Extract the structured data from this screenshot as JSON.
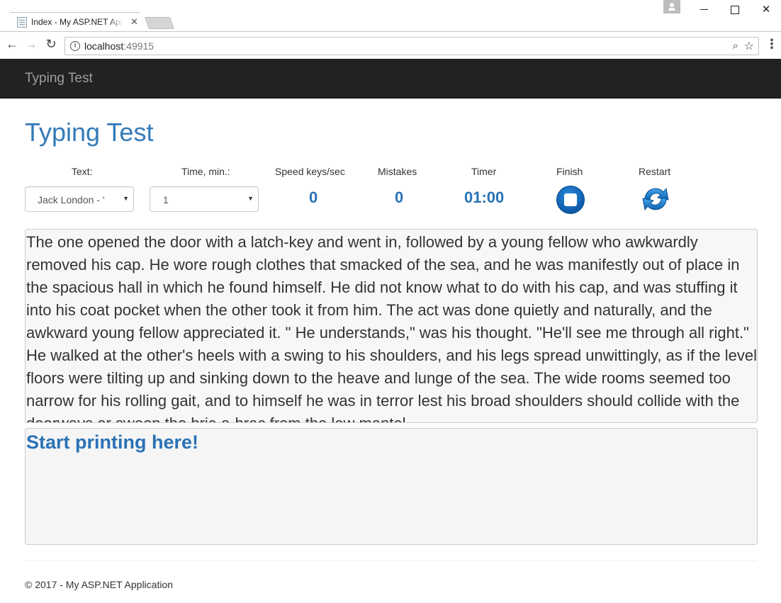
{
  "browser": {
    "tab_title": "Index - My ASP.NET Application",
    "url_host": "localhost",
    "url_port": ":49915",
    "icons": [
      "favicon-icon",
      "close-icon",
      "back-icon",
      "forward-icon",
      "reload-icon",
      "info-icon",
      "zoom-icon",
      "star-icon",
      "menu-icon",
      "profile-icon"
    ]
  },
  "navbar": {
    "brand": "Typing Test"
  },
  "page": {
    "title": "Typing Test"
  },
  "controls": {
    "text_label": "Text:",
    "text_selected": "Jack London - '",
    "time_label": "Time, min.:",
    "time_selected": "1",
    "speed_label": "Speed keys/sec",
    "speed_value": "0",
    "mistakes_label": "Mistakes",
    "mistakes_value": "0",
    "timer_label": "Timer",
    "timer_value": "01:00",
    "finish_label": "Finish",
    "restart_label": "Restart",
    "colors": {
      "accent": "#337ab7",
      "value": "#2a72b5",
      "navbar": "#222222"
    }
  },
  "passage": {
    "text": "The one opened the door with a latch-key and went in, followed by a young fellow who awkwardly removed his cap. He wore rough clothes that smacked of the sea, and he was manifestly out of place in the spacious hall in which he found himself. He did not know what to do with his cap, and was stuffing it into his coat pocket when the other took it from him. The act was done quietly and naturally, and the awkward young fellow appreciated it. \" He understands,\" was his thought. \"He'll see me through all right.\" He walked at the other's heels with a swing to his shoulders, and his legs spread unwittingly, as if the level floors were tilting up and sinking down to the heave and lunge of the sea. The wide rooms seemed too narrow for his rolling gait, and to himself he was in terror lest his broad shoulders should collide with the doorways or sweep the bric-a-brac from the low mantel."
  },
  "typing": {
    "prompt": "Start printing here!"
  },
  "footer": {
    "text": "© 2017 - My ASP.NET Application"
  }
}
